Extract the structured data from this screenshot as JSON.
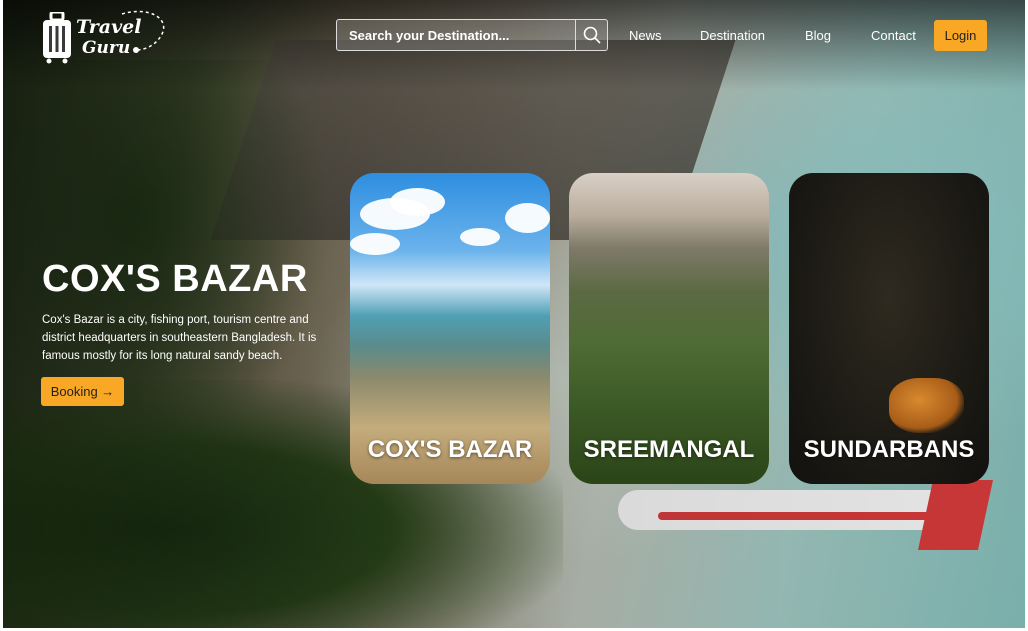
{
  "header": {
    "logo": {
      "line1": "Travel",
      "line2": "Guru"
    },
    "search": {
      "placeholder": "Search your Destination..."
    },
    "nav": [
      "News",
      "Destination",
      "Blog",
      "Contact"
    ],
    "login_label": "Login"
  },
  "hero": {
    "title": "COX'S BAZAR",
    "description": "Cox's Bazar is a city, fishing port, tourism centre and district headquarters in southeastern Bangladesh. It is famous mostly for its long natural sandy beach.",
    "booking_label": "Booking →"
  },
  "cards": [
    {
      "label": "COX'S BAZAR"
    },
    {
      "label": "SREEMANGAL"
    },
    {
      "label": "SUNDARBANS"
    }
  ],
  "colors": {
    "accent": "#f9a825"
  },
  "icons": {
    "search": "search-icon",
    "logo": "suitcase-icon"
  }
}
